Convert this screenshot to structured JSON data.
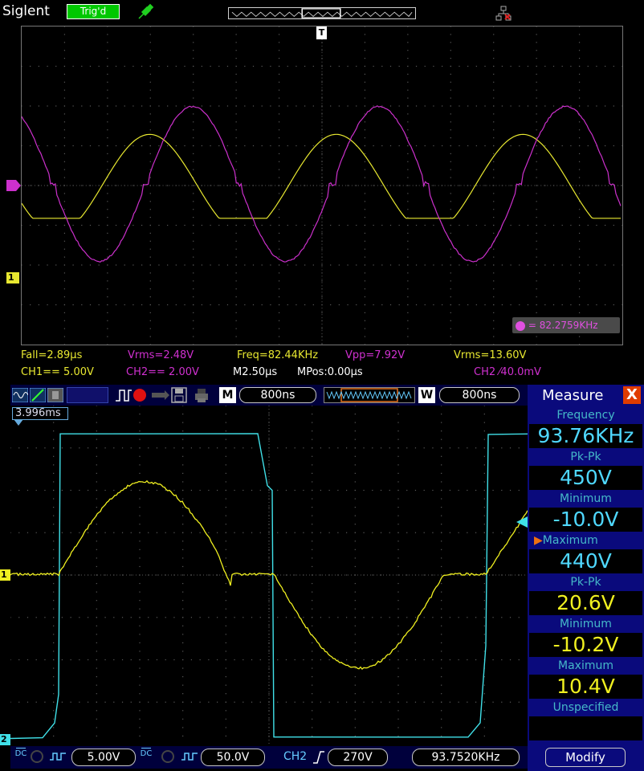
{
  "scope1": {
    "brand": "Siglent",
    "trigger_status": "Trig'd",
    "trigger_marker": "T",
    "measurements_row1": {
      "fall": "Fall=2.89µs",
      "vrms_ch2": "Vrms=2.48V",
      "freq": "Freq=82.44KHz",
      "vpp": "Vpp=7.92V",
      "vrms_ch1": "Vrms=13.60V"
    },
    "measurements_row2": {
      "ch1_scale": "CH1== 5.00V",
      "ch2_scale": "CH2== 2.00V",
      "timebase": "M2.50µs",
      "mpos": "MPos:0.00µs",
      "trigger": "CH2 ⁄40.0mV"
    },
    "freq_readout": "= 82.2759KHz",
    "ch1_marker": "1"
  },
  "scope2": {
    "toolbar": {
      "m_key": "M",
      "m_value": "800ns",
      "w_key": "W",
      "w_value": "800ns"
    },
    "cursor_label": "3.996ms",
    "ch1_marker": "1",
    "ch2_marker": "2",
    "bottom": {
      "ch1_coupling": "DC",
      "ch1_scale": "5.00V",
      "ch2_coupling": "DC",
      "ch2_scale": "50.0V",
      "trig_source": "CH2",
      "trig_level": "270V",
      "trig_freq": "93.7520KHz"
    }
  },
  "measure_panel": {
    "title": "Measure",
    "close": "X",
    "items": [
      {
        "label": "Frequency",
        "value": "93.76KHz",
        "color": "#4fd8ff"
      },
      {
        "label": "Pk-Pk",
        "value": "450V",
        "color": "#4fd8ff"
      },
      {
        "label": "Minimum",
        "value": "-10.0V",
        "color": "#4fd8ff"
      },
      {
        "label": "▶Maximum",
        "value": "440V",
        "color": "#4fd8ff"
      },
      {
        "label": "Pk-Pk",
        "value": "20.6V",
        "color": "#f0f020"
      },
      {
        "label": "Minimum",
        "value": "-10.2V",
        "color": "#f0f020"
      },
      {
        "label": "Maximum",
        "value": "10.4V",
        "color": "#f0f020"
      },
      {
        "label": "Unspecified",
        "value": "",
        "color": "#f0f020"
      }
    ],
    "modify": "Modify"
  },
  "colors": {
    "ch1": "#e8e830",
    "ch2_top": "#cc30cc",
    "ch2_bottom": "#40e0e8",
    "grid": "#5a5a5a"
  }
}
